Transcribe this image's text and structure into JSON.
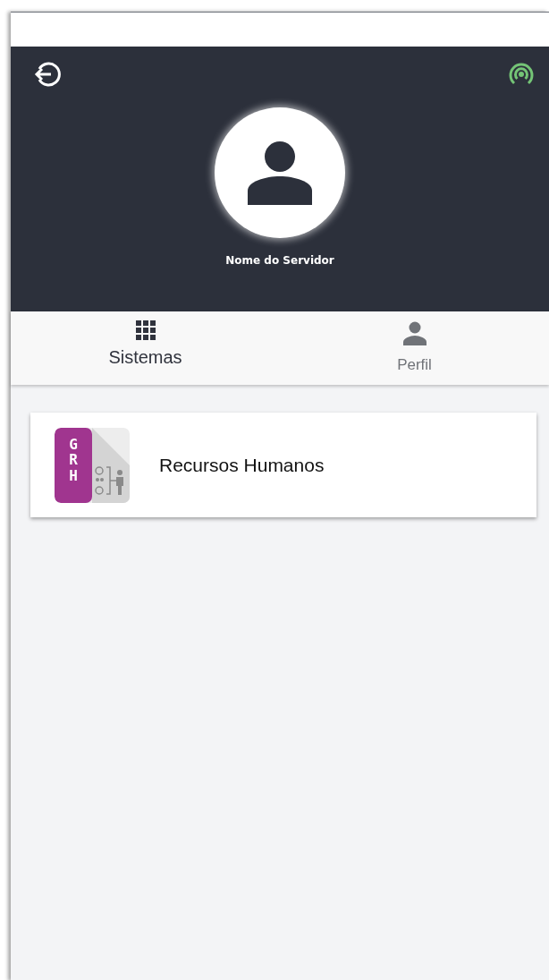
{
  "header": {
    "user_name": "Nome do Servidor",
    "connected": true
  },
  "tabs": [
    {
      "label": "Sistemas",
      "kind": "grid",
      "selected": true
    },
    {
      "label": "Perfil",
      "kind": "person",
      "selected": false
    }
  ],
  "systems": [
    {
      "name": "Recursos Humanos",
      "logo_text": "GRH"
    }
  ]
}
